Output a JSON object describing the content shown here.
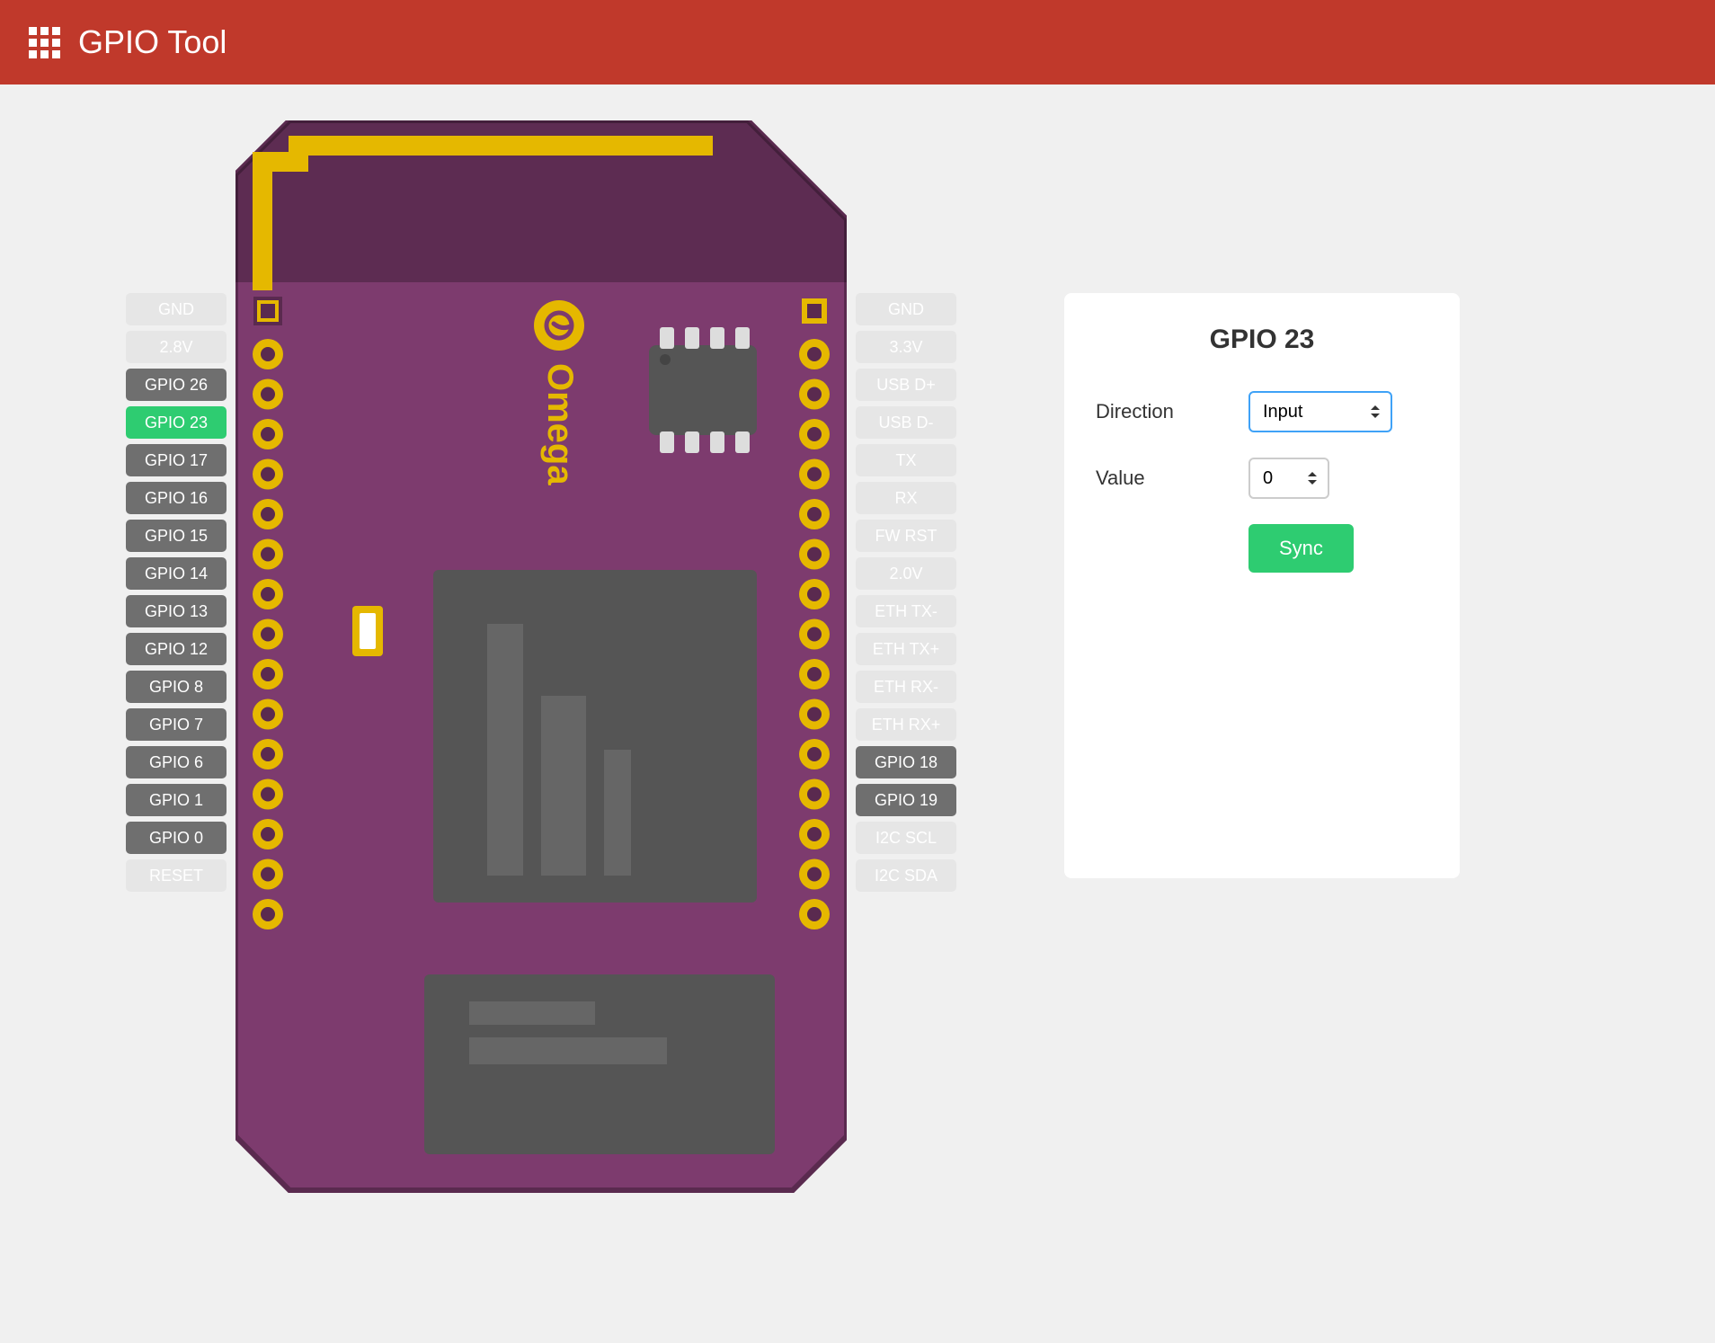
{
  "header": {
    "title": "GPIO Tool"
  },
  "board": {
    "brand": "Omega"
  },
  "pins": {
    "left": [
      {
        "label": "GND",
        "state": "disabled"
      },
      {
        "label": "2.8V",
        "state": "disabled"
      },
      {
        "label": "GPIO 26",
        "state": "enabled"
      },
      {
        "label": "GPIO 23",
        "state": "selected"
      },
      {
        "label": "GPIO 17",
        "state": "enabled"
      },
      {
        "label": "GPIO 16",
        "state": "enabled"
      },
      {
        "label": "GPIO 15",
        "state": "enabled"
      },
      {
        "label": "GPIO 14",
        "state": "enabled"
      },
      {
        "label": "GPIO 13",
        "state": "enabled"
      },
      {
        "label": "GPIO 12",
        "state": "enabled"
      },
      {
        "label": "GPIO 8",
        "state": "enabled"
      },
      {
        "label": "GPIO 7",
        "state": "enabled"
      },
      {
        "label": "GPIO 6",
        "state": "enabled"
      },
      {
        "label": "GPIO 1",
        "state": "enabled"
      },
      {
        "label": "GPIO 0",
        "state": "enabled"
      },
      {
        "label": "RESET",
        "state": "disabled"
      }
    ],
    "right": [
      {
        "label": "GND",
        "state": "disabled"
      },
      {
        "label": "3.3V",
        "state": "disabled"
      },
      {
        "label": "USB D+",
        "state": "disabled"
      },
      {
        "label": "USB D-",
        "state": "disabled"
      },
      {
        "label": "TX",
        "state": "disabled"
      },
      {
        "label": "RX",
        "state": "disabled"
      },
      {
        "label": "FW RST",
        "state": "disabled"
      },
      {
        "label": "2.0V",
        "state": "disabled"
      },
      {
        "label": "ETH TX-",
        "state": "disabled"
      },
      {
        "label": "ETH TX+",
        "state": "disabled"
      },
      {
        "label": "ETH RX-",
        "state": "disabled"
      },
      {
        "label": "ETH RX+",
        "state": "disabled"
      },
      {
        "label": "GPIO 18",
        "state": "enabled"
      },
      {
        "label": "GPIO 19",
        "state": "enabled"
      },
      {
        "label": "I2C SCL",
        "state": "disabled"
      },
      {
        "label": "I2C SDA",
        "state": "disabled"
      }
    ]
  },
  "panel": {
    "title": "GPIO 23",
    "direction_label": "Direction",
    "direction_value": "Input",
    "value_label": "Value",
    "value_value": "0",
    "sync_label": "Sync"
  }
}
